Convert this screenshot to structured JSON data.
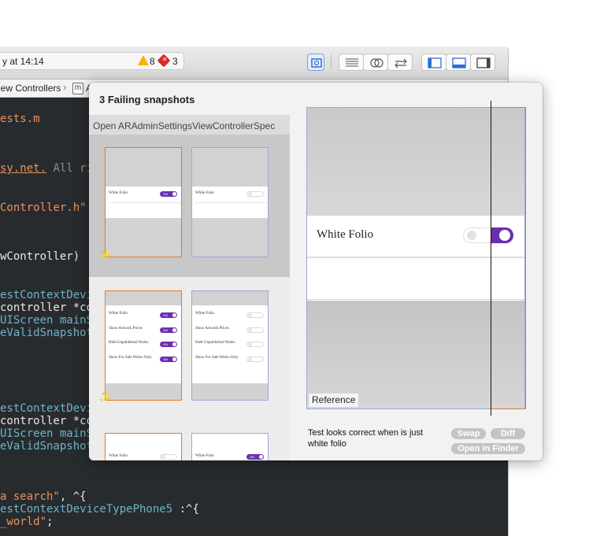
{
  "toolbar": {
    "activity_status": "y at 14:14",
    "warning_count": "8",
    "error_count": "3"
  },
  "jumpbar": {
    "crumb1": "iew Controllers",
    "crumb2": "A"
  },
  "editor": {
    "lines": [
      {
        "text": "ests.m",
        "color": "#e8925c"
      },
      {
        "text": "sy.net.",
        "color": "#e8925c",
        "rest": " All ri",
        "rest_color": "#8b8b8b"
      },
      {
        "text": "Controller.h\"",
        "color": "#e8925c"
      },
      {
        "text": "wController)",
        "color": "#e8e8e8"
      },
      {
        "text": "estContextDevi",
        "color": "#6cb4c9"
      },
      {
        "text": "controller *con",
        "color": "#e8e8e8"
      },
      {
        "text": "UIScreen mainS",
        "color": "#6cb4c9"
      },
      {
        "text": "eValidSnapshot",
        "color": "#6cb4c9"
      },
      {
        "text": "estContextDevi",
        "color": "#6cb4c9"
      },
      {
        "text": "controller *con",
        "color": "#e8e8e8"
      },
      {
        "text": "UIScreen mainS",
        "color": "#6cb4c9"
      },
      {
        "text": "eValidSnapshot",
        "color": "#6cb4c9"
      },
      {
        "text": "a search\"",
        "color": "#e8925c",
        "rest": ", ^{",
        "rest_color": "#e8e8e8"
      },
      {
        "text": "estContextDeviceTypePhone5",
        "color": "#6cb4c9",
        "rest": " :^{",
        "rest_color": "#e8e8e8"
      },
      {
        "text": "_world\"",
        "color": "#e8925c",
        "rest": ";",
        "rest_color": "#e8e8e8"
      }
    ]
  },
  "popover": {
    "title": "3 Failing snapshots",
    "open_label": "Open ARAdminSettingsViewControllerSpec",
    "reference_label": "Reference",
    "description": "Test looks correct when  is just white folio",
    "swap_label": "Swap",
    "diff_label": "Diff",
    "finder_label": "Open in Finder"
  },
  "snapshots": {
    "row1_label": "White Folio",
    "row2_labels": [
      "White Folio",
      "Show Artwork Prices",
      "Hide Unpublished Works",
      "Show For Sale Works Only"
    ],
    "toggle_on": "ON",
    "toggle_off": "OFF"
  },
  "preview": {
    "label": "White Folio"
  },
  "colors": {
    "accent_purple": "#6a2fb0",
    "fail_border": "#e07b2f",
    "ref_border": "#9aa8d6"
  }
}
